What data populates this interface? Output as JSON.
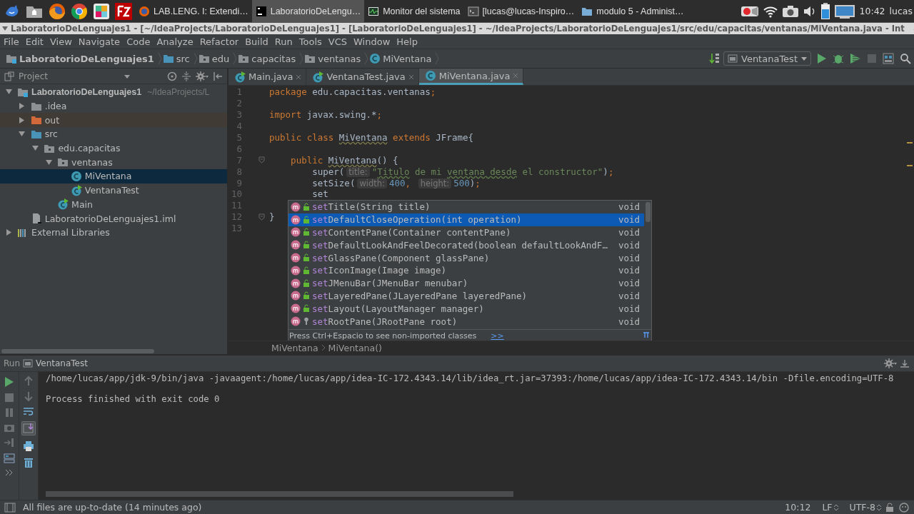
{
  "taskbar": {
    "tasks": [
      {
        "label": "LAB.LENG. I: Extendi…",
        "kind": "browser",
        "selected": false
      },
      {
        "label": "LaboratorioDeLengu…",
        "kind": "ide",
        "selected": true
      },
      {
        "label": "Monitor del sistema",
        "kind": "monitor",
        "selected": false
      },
      {
        "label": "[lucas@lucas-Inspiro…",
        "kind": "terminal",
        "selected": false
      },
      {
        "label": "modulo 5 - Administ…",
        "kind": "folder",
        "selected": false
      }
    ],
    "clock": "10:42",
    "user": "lucas"
  },
  "window": {
    "title": "LaboratorioDeLenguajes1 - [~/IdeaProjects/LaboratorioDeLenguajes1] - [LaboratorioDeLenguajes1] - ~/IdeaProjects/LaboratorioDeLenguajes1/src/edu/capacitas/ventanas/MiVentana.java - Int"
  },
  "menu": [
    "File",
    "Edit",
    "View",
    "Navigate",
    "Code",
    "Analyze",
    "Refactor",
    "Build",
    "Run",
    "Tools",
    "VCS",
    "Window",
    "Help"
  ],
  "navbar": {
    "crumbs": [
      {
        "label": "LaboratorioDeLenguajes1",
        "kind": "module"
      },
      {
        "label": "src",
        "kind": "source-folder"
      },
      {
        "label": "edu",
        "kind": "package"
      },
      {
        "label": "capacitas",
        "kind": "package"
      },
      {
        "label": "ventanas",
        "kind": "package"
      },
      {
        "label": "MiVentana",
        "kind": "class"
      }
    ],
    "run_config": "VentanaTest"
  },
  "project": {
    "title": "Project",
    "tree": [
      {
        "label": "LaboratorioDeLenguajes1",
        "hint": "~/IdeaProjects/L",
        "kind": "module",
        "expanded": true,
        "selected": false,
        "children": [
          {
            "label": ".idea",
            "kind": "folder",
            "expanded": false,
            "selected": false
          },
          {
            "label": "out",
            "kind": "excluded-folder",
            "expanded": false,
            "selected": false
          },
          {
            "label": "src",
            "kind": "source-folder",
            "expanded": true,
            "selected": false,
            "children": [
              {
                "label": "edu.capacitas",
                "kind": "package",
                "expanded": true,
                "selected": false,
                "children": [
                  {
                    "label": "ventanas",
                    "kind": "package",
                    "expanded": true,
                    "selected": false,
                    "children": [
                      {
                        "label": "MiVentana",
                        "kind": "class",
                        "selected": true
                      },
                      {
                        "label": "VentanaTest",
                        "kind": "runnable-class",
                        "selected": false
                      }
                    ]
                  },
                  {
                    "label": "Main",
                    "kind": "runnable-class",
                    "selected": false
                  }
                ]
              }
            ]
          },
          {
            "label": "LaboratorioDeLenguajes1.iml",
            "kind": "iml-file",
            "selected": false
          }
        ]
      },
      {
        "label": "External Libraries",
        "kind": "libraries",
        "expanded": false,
        "selected": false
      }
    ]
  },
  "editor": {
    "tabs": [
      {
        "label": "Main.java",
        "kind": "runnable-class",
        "selected": false
      },
      {
        "label": "VentanaTest.java",
        "kind": "runnable-class",
        "selected": false
      },
      {
        "label": "MiVentana.java",
        "kind": "class",
        "selected": true
      }
    ],
    "lines": [
      {
        "number": "1",
        "fold": false,
        "tokens": [
          {
            "kind": "keyword",
            "text": "package"
          },
          {
            "kind": "plain",
            "text": " edu.capacitas.ventanas"
          },
          {
            "kind": "keyword",
            "text": ";"
          }
        ]
      },
      {
        "number": "2",
        "fold": false
      },
      {
        "number": "3",
        "fold": false,
        "tokens": [
          {
            "kind": "keyword",
            "text": "import"
          },
          {
            "kind": "plain",
            "text": " javax.swing.*"
          },
          {
            "kind": "keyword",
            "text": ";"
          }
        ]
      },
      {
        "number": "4",
        "fold": false
      },
      {
        "number": "5",
        "fold": false,
        "tokens": [
          {
            "kind": "keyword",
            "text": "public class "
          },
          {
            "kind": "warn",
            "text": "MiVentana"
          },
          {
            "kind": "keyword",
            "text": " extends "
          },
          {
            "kind": "plain",
            "text": "JFrame{"
          }
        ]
      },
      {
        "number": "6",
        "fold": false
      },
      {
        "number": "7",
        "fold": true,
        "tokens": [
          {
            "kind": "keyword",
            "text": "    public "
          },
          {
            "kind": "warn",
            "text": "MiVentana"
          },
          {
            "kind": "plain",
            "text": "() {"
          }
        ]
      },
      {
        "number": "8",
        "fold": false,
        "tokens": [
          {
            "kind": "plain",
            "text": "        super("
          },
          {
            "kind": "hint",
            "text": "title:"
          },
          {
            "kind": "string",
            "text": "\""
          },
          {
            "kind": "typo",
            "text": "Titulo"
          },
          {
            "kind": "string",
            "text": " de mi "
          },
          {
            "kind": "typo",
            "text": "ventana desde"
          },
          {
            "kind": "string",
            "text": " el constructor\""
          },
          {
            "kind": "plain",
            "text": ")"
          },
          {
            "kind": "keyword",
            "text": ";"
          }
        ]
      },
      {
        "number": "9",
        "fold": false,
        "tokens": [
          {
            "kind": "plain",
            "text": "        setSize("
          },
          {
            "kind": "hint",
            "text": "width:"
          },
          {
            "kind": "number",
            "text": "400"
          },
          {
            "kind": "keyword",
            "text": ", "
          },
          {
            "kind": "hint",
            "text": "height:"
          },
          {
            "kind": "number",
            "text": "500"
          },
          {
            "kind": "plain",
            "text": ")"
          },
          {
            "kind": "keyword",
            "text": ";"
          }
        ]
      },
      {
        "number": "10",
        "fold": false,
        "tokens": [
          {
            "kind": "plain",
            "text": "        set"
          }
        ]
      },
      {
        "number": "11",
        "fold": false
      },
      {
        "number": "12",
        "fold": true,
        "tokens": [
          {
            "kind": "plain",
            "text": "}"
          }
        ]
      },
      {
        "number": "13",
        "fold": false
      }
    ],
    "completion": {
      "items": [
        {
          "matched": "set",
          "rest": "Title(String title)",
          "type": "void",
          "kind": "public",
          "selected": false
        },
        {
          "matched": "set",
          "rest": "DefaultCloseOperation(int operation)",
          "type": "void",
          "kind": "public",
          "selected": true
        },
        {
          "matched": "set",
          "rest": "ContentPane(Container contentPane)",
          "type": "void",
          "kind": "public",
          "selected": false
        },
        {
          "matched": "set",
          "rest": "DefaultLookAndFeelDecorated(boolean defaultLookAndF…",
          "type": "void",
          "kind": "public",
          "selected": false
        },
        {
          "matched": "set",
          "rest": "GlassPane(Component glassPane)",
          "type": "void",
          "kind": "public",
          "selected": false
        },
        {
          "matched": "set",
          "rest": "IconImage(Image image)",
          "type": "void",
          "kind": "public",
          "selected": false
        },
        {
          "matched": "set",
          "rest": "JMenuBar(JMenuBar menubar)",
          "type": "void",
          "kind": "public",
          "selected": false
        },
        {
          "matched": "set",
          "rest": "LayeredPane(JLayeredPane layeredPane)",
          "type": "void",
          "kind": "public",
          "selected": false
        },
        {
          "matched": "set",
          "rest": "Layout(LayoutManager manager)",
          "type": "void",
          "kind": "public",
          "selected": false
        },
        {
          "matched": "set",
          "rest": "RootPane(JRootPane root)",
          "type": "void",
          "kind": "protected",
          "selected": false
        }
      ],
      "footer": "Press Ctrl+Espacio to see non-imported classes",
      "link": ">>"
    },
    "breadcrumb": [
      "MiVentana",
      "MiVentana()"
    ]
  },
  "run_panel": {
    "title": "Run",
    "config": "VentanaTest",
    "scroll_to_end_on": true,
    "console": [
      "/home/lucas/app/jdk-9/bin/java -javaagent:/home/lucas/app/idea-IC-172.4343.14/lib/idea_rt.jar=37393:/home/lucas/app/idea-IC-172.4343.14/bin -Dfile.encoding=UTF-8",
      "Process finished with exit code 0"
    ]
  },
  "status_bar": {
    "message": "All files are up-to-date (14 minutes ago)",
    "caret": "10:12",
    "line_separator": "LF",
    "encoding": "UTF-8"
  }
}
